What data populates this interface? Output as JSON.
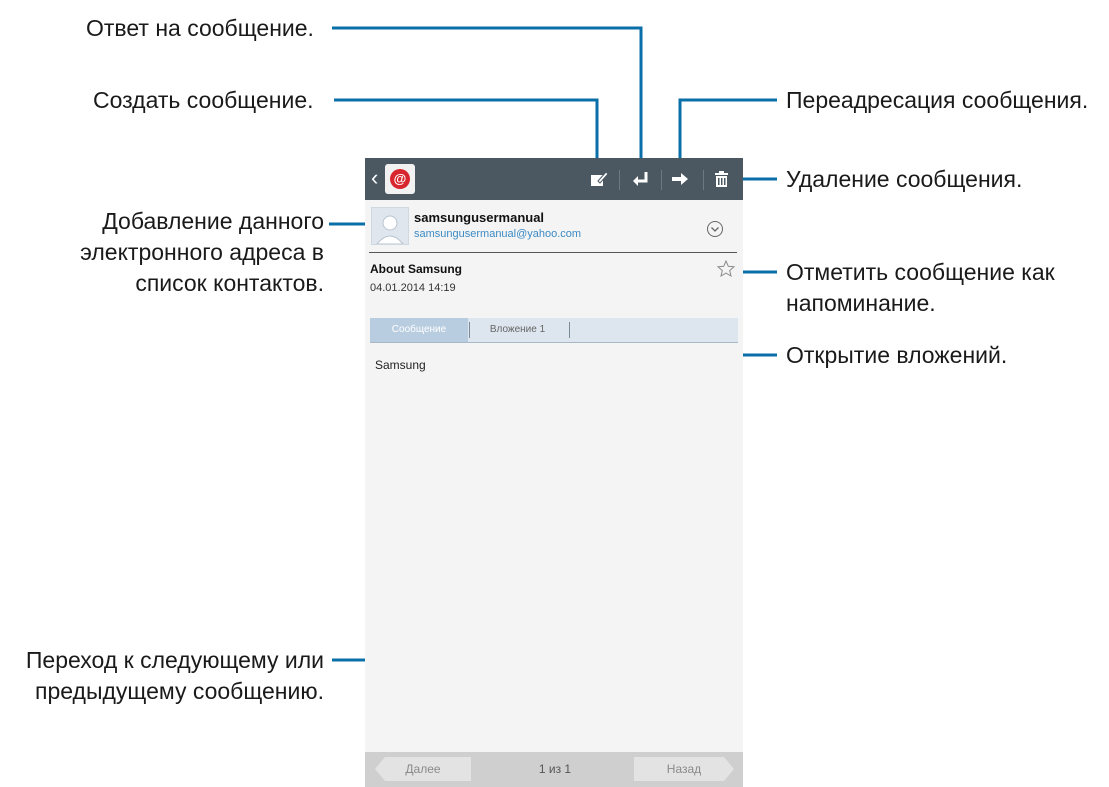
{
  "annotations": {
    "reply": "Ответ на сообщение.",
    "compose": "Создать сообщение.",
    "forward": "Переадресация сообщения.",
    "delete": "Удаление сообщения.",
    "add_contact_line1": "Добавление данного",
    "add_contact_line2": "электронного адреса в",
    "add_contact_line3": "список контактов.",
    "mark_line1": "Отметить сообщение как",
    "mark_line2": "напоминание.",
    "attachments": "Открытие вложений.",
    "nav_line1": "Переход к следующему или",
    "nav_line2": "предыдущему сообщению."
  },
  "app": {
    "icon": "email-app-icon",
    "actions": [
      "compose-icon",
      "reply-icon",
      "forward-icon",
      "trash-icon"
    ]
  },
  "sender": {
    "name": "samsungusermanual",
    "email": "samsungusermanual@yahoo.com"
  },
  "message": {
    "subject": "About Samsung",
    "date": "04.01.2014 14:19",
    "body": "Samsung"
  },
  "tabs": {
    "message": "Сообщение",
    "attachment": "Вложение 1"
  },
  "bottom_nav": {
    "next": "Далее",
    "counter": "1 из 1",
    "prev": "Назад"
  },
  "colors": {
    "action_bar": "#4b5862",
    "accent": "#0a6fa8",
    "link": "#3b8ac4"
  }
}
